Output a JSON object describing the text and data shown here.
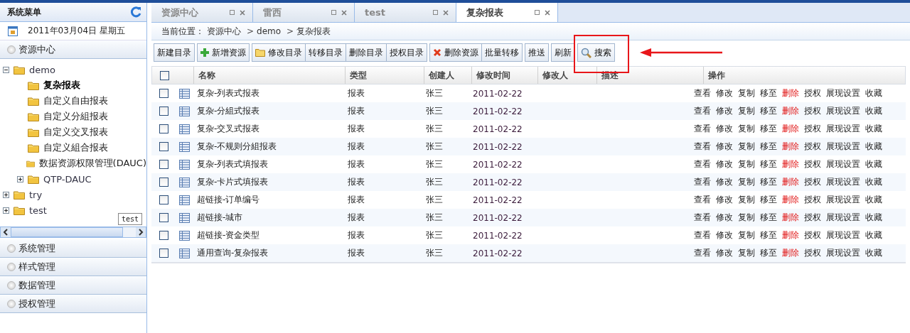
{
  "sidebar": {
    "title": "系统菜单",
    "date": "2011年03月04日  星期五",
    "sections": [
      {
        "label": "资源中心",
        "expanded": true
      },
      {
        "label": "系统管理",
        "expanded": false
      },
      {
        "label": "样式管理",
        "expanded": false
      },
      {
        "label": "数据管理",
        "expanded": false
      },
      {
        "label": "授权管理",
        "expanded": false
      }
    ],
    "tree": [
      {
        "label": "demo",
        "expanded": true,
        "selected": false,
        "children": [
          {
            "label": "复杂报表",
            "selected": true
          },
          {
            "label": "自定义自由报表",
            "selected": false
          },
          {
            "label": "自定义分組报表",
            "selected": false
          },
          {
            "label": "自定义交叉报表",
            "selected": false
          },
          {
            "label": "自定义組合报表",
            "selected": false
          },
          {
            "label": "数据资源权限管理(DAUC)",
            "selected": false
          },
          {
            "label": "QTP-DAUC",
            "selected": false,
            "expanded": false
          }
        ]
      },
      {
        "label": "try",
        "selected": false,
        "expanded": false
      },
      {
        "label": "test",
        "selected": false,
        "expanded": false
      }
    ],
    "tooltip": "test"
  },
  "tabs": [
    {
      "label": "资源中心",
      "selected": false
    },
    {
      "label": "雷西",
      "selected": false
    },
    {
      "label": "test",
      "selected": false
    },
    {
      "label": "复杂报表",
      "selected": true
    }
  ],
  "breadcrumb": {
    "label": "当前位置：",
    "separator": ">",
    "path": [
      "资源中心",
      "demo",
      "复杂报表"
    ]
  },
  "toolbar": [
    [
      {
        "label": "新建目录",
        "kind": "plain",
        "highlighted": false
      }
    ],
    [
      {
        "label": "新增资源",
        "kind": "add",
        "highlighted": false
      }
    ],
    [
      {
        "label": "修改目录",
        "kind": "folder",
        "highlighted": false
      },
      {
        "label": "转移目录",
        "kind": "plain",
        "highlighted": false
      },
      {
        "label": "删除目录",
        "kind": "plain",
        "highlighted": false
      },
      {
        "label": "授权目录",
        "kind": "plain",
        "highlighted": false
      }
    ],
    [
      {
        "label": "删除资源",
        "kind": "delete",
        "highlighted": false
      },
      {
        "label": "批量转移",
        "kind": "plain",
        "highlighted": false
      }
    ],
    [
      {
        "label": "推送",
        "kind": "plain",
        "highlighted": false
      }
    ],
    [
      {
        "label": "刷新",
        "kind": "plain",
        "highlighted": false
      }
    ],
    [
      {
        "label": "搜索",
        "kind": "search",
        "highlighted": true
      }
    ]
  ],
  "table": {
    "select_all": false,
    "columns": [
      "名称",
      "类型",
      "创建人",
      "修改时间",
      "修改人",
      "描述",
      "操作"
    ],
    "rows": [
      {
        "checked": false,
        "name": "复杂-列表式报表",
        "type": "报表",
        "creator": "张三",
        "modified": "2011-02-22",
        "actions": [
          {
            "label": "查看",
            "danger": false
          },
          {
            "label": "修改",
            "danger": false
          },
          {
            "label": "复制",
            "danger": false
          },
          {
            "label": "移至",
            "danger": false
          },
          {
            "label": "删除",
            "danger": true
          },
          {
            "label": "授权",
            "danger": false
          },
          {
            "label": "展现设置",
            "danger": false
          },
          {
            "label": "收藏",
            "danger": false
          }
        ]
      },
      {
        "checked": false,
        "name": "复杂-分組式报表",
        "type": "报表",
        "creator": "张三",
        "modified": "2011-02-22",
        "actions": [
          {
            "label": "查看",
            "danger": false
          },
          {
            "label": "修改",
            "danger": false
          },
          {
            "label": "复制",
            "danger": false
          },
          {
            "label": "移至",
            "danger": false
          },
          {
            "label": "删除",
            "danger": true
          },
          {
            "label": "授权",
            "danger": false
          },
          {
            "label": "展现设置",
            "danger": false
          },
          {
            "label": "收藏",
            "danger": false
          }
        ]
      },
      {
        "checked": false,
        "name": "复杂-交叉式报表",
        "type": "报表",
        "creator": "张三",
        "modified": "2011-02-22",
        "actions": [
          {
            "label": "查看",
            "danger": false
          },
          {
            "label": "修改",
            "danger": false
          },
          {
            "label": "复制",
            "danger": false
          },
          {
            "label": "移至",
            "danger": false
          },
          {
            "label": "删除",
            "danger": true
          },
          {
            "label": "授权",
            "danger": false
          },
          {
            "label": "展现设置",
            "danger": false
          },
          {
            "label": "收藏",
            "danger": false
          }
        ]
      },
      {
        "checked": false,
        "name": "复杂-不规则分組报表",
        "type": "报表",
        "creator": "张三",
        "modified": "2011-02-22",
        "actions": [
          {
            "label": "查看",
            "danger": false
          },
          {
            "label": "修改",
            "danger": false
          },
          {
            "label": "复制",
            "danger": false
          },
          {
            "label": "移至",
            "danger": false
          },
          {
            "label": "删除",
            "danger": true
          },
          {
            "label": "授权",
            "danger": false
          },
          {
            "label": "展现设置",
            "danger": false
          },
          {
            "label": "收藏",
            "danger": false
          }
        ]
      },
      {
        "checked": false,
        "name": "复杂-列表式填报表",
        "type": "报表",
        "creator": "张三",
        "modified": "2011-02-22",
        "actions": [
          {
            "label": "查看",
            "danger": false
          },
          {
            "label": "修改",
            "danger": false
          },
          {
            "label": "复制",
            "danger": false
          },
          {
            "label": "移至",
            "danger": false
          },
          {
            "label": "删除",
            "danger": true
          },
          {
            "label": "授权",
            "danger": false
          },
          {
            "label": "展现设置",
            "danger": false
          },
          {
            "label": "收藏",
            "danger": false
          }
        ]
      },
      {
        "checked": false,
        "name": "复杂-卡片式填报表",
        "type": "报表",
        "creator": "张三",
        "modified": "2011-02-22",
        "actions": [
          {
            "label": "查看",
            "danger": false
          },
          {
            "label": "修改",
            "danger": false
          },
          {
            "label": "复制",
            "danger": false
          },
          {
            "label": "移至",
            "danger": false
          },
          {
            "label": "删除",
            "danger": true
          },
          {
            "label": "授权",
            "danger": false
          },
          {
            "label": "展现设置",
            "danger": false
          },
          {
            "label": "收藏",
            "danger": false
          }
        ]
      },
      {
        "checked": false,
        "name": "超链接-订单编号",
        "type": "报表",
        "creator": "张三",
        "modified": "2011-02-22",
        "actions": [
          {
            "label": "查看",
            "danger": false
          },
          {
            "label": "修改",
            "danger": false
          },
          {
            "label": "复制",
            "danger": false
          },
          {
            "label": "移至",
            "danger": false
          },
          {
            "label": "删除",
            "danger": true
          },
          {
            "label": "授权",
            "danger": false
          },
          {
            "label": "展现设置",
            "danger": false
          },
          {
            "label": "收藏",
            "danger": false
          }
        ]
      },
      {
        "checked": false,
        "name": "超链接-城市",
        "type": "报表",
        "creator": "张三",
        "modified": "2011-02-22",
        "actions": [
          {
            "label": "查看",
            "danger": false
          },
          {
            "label": "修改",
            "danger": false
          },
          {
            "label": "复制",
            "danger": false
          },
          {
            "label": "移至",
            "danger": false
          },
          {
            "label": "删除",
            "danger": true
          },
          {
            "label": "授权",
            "danger": false
          },
          {
            "label": "展现设置",
            "danger": false
          },
          {
            "label": "收藏",
            "danger": false
          }
        ]
      },
      {
        "checked": false,
        "name": "超链接-资金类型",
        "type": "报表",
        "creator": "张三",
        "modified": "2011-02-22",
        "actions": [
          {
            "label": "查看",
            "danger": false
          },
          {
            "label": "修改",
            "danger": false
          },
          {
            "label": "复制",
            "danger": false
          },
          {
            "label": "移至",
            "danger": false
          },
          {
            "label": "删除",
            "danger": true
          },
          {
            "label": "授权",
            "danger": false
          },
          {
            "label": "展现设置",
            "danger": false
          },
          {
            "label": "收藏",
            "danger": false
          }
        ]
      },
      {
        "checked": false,
        "name": "通用查询-复杂报表",
        "type": "报表",
        "creator": "张三",
        "modified": "2011-02-22",
        "actions": [
          {
            "label": "查看",
            "danger": false
          },
          {
            "label": "修改",
            "danger": false
          },
          {
            "label": "复制",
            "danger": false
          },
          {
            "label": "移至",
            "danger": false
          },
          {
            "label": "删除",
            "danger": true
          },
          {
            "label": "授权",
            "danger": false
          },
          {
            "label": "展现设置",
            "danger": false
          },
          {
            "label": "收藏",
            "danger": false
          }
        ]
      }
    ]
  }
}
